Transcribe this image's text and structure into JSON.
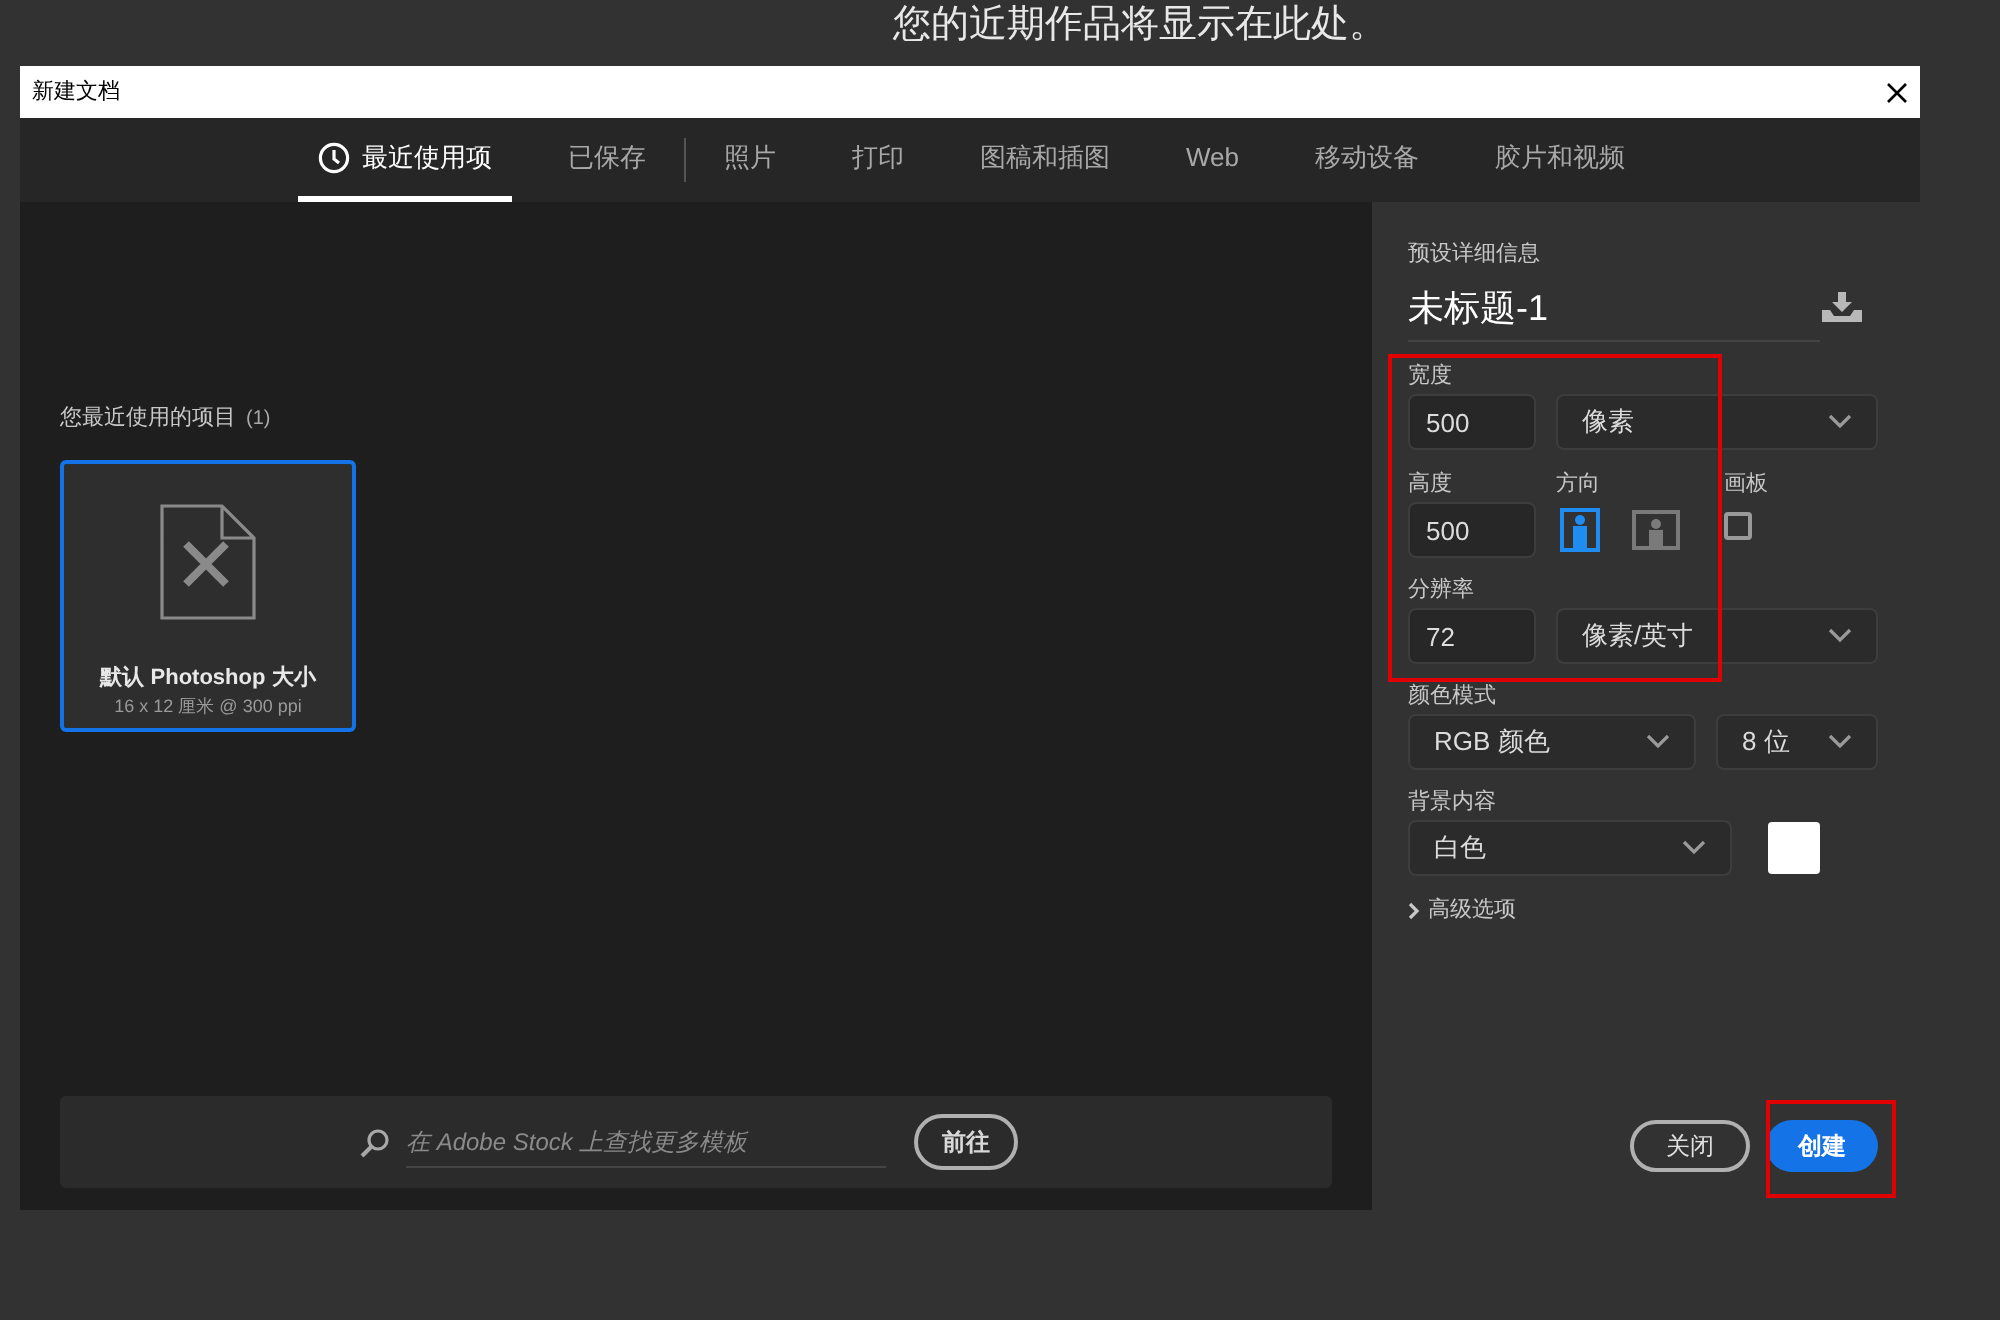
{
  "headline": "您的近期作品将显示在此处。",
  "dialog": {
    "title": "新建文档"
  },
  "tabs": [
    {
      "label": "最近使用项",
      "selected": true,
      "kind": "clock"
    },
    {
      "label": "已保存",
      "selected": false,
      "kind": "divided"
    },
    {
      "label": "照片",
      "selected": false,
      "kind": "plain"
    },
    {
      "label": "打印",
      "selected": false,
      "kind": "plain"
    },
    {
      "label": "图稿和插图",
      "selected": false,
      "kind": "plain"
    },
    {
      "label": "Web",
      "selected": false,
      "kind": "plain"
    },
    {
      "label": "移动设备",
      "selected": false,
      "kind": "plain"
    },
    {
      "label": "胶片和视频",
      "selected": false,
      "kind": "plain"
    }
  ],
  "recent": {
    "heading": "您最近使用的项目",
    "count": "(1)",
    "items": [
      {
        "name": "默认 Photoshop 大小",
        "spec": "16 x 12 厘米 @ 300 ppi",
        "selected": true
      }
    ]
  },
  "search": {
    "placeholder": "在 Adobe Stock 上查找更多模板",
    "button": "前往"
  },
  "preset": {
    "label": "预设详细信息",
    "name": "未标题-1",
    "width": {
      "label": "宽度",
      "value": "500",
      "unit": "像素"
    },
    "height": {
      "label": "高度",
      "value": "500"
    },
    "orientation": {
      "label": "方向",
      "options": [
        {
          "kind": "portrait",
          "selected": true
        },
        {
          "kind": "landscape",
          "selected": false
        }
      ]
    },
    "artboard": {
      "label": "画板",
      "checked": false
    },
    "resolution": {
      "label": "分辨率",
      "value": "72",
      "unit": "像素/英寸"
    },
    "color_mode": {
      "label": "颜色模式",
      "mode": "RGB 颜色",
      "bits": "8 位"
    },
    "background": {
      "label": "背景内容",
      "value": "白色",
      "color": "#ffffff"
    },
    "advanced": {
      "label": "高级选项",
      "expanded": false
    }
  },
  "buttons": {
    "close": "关闭",
    "create": "创建"
  }
}
